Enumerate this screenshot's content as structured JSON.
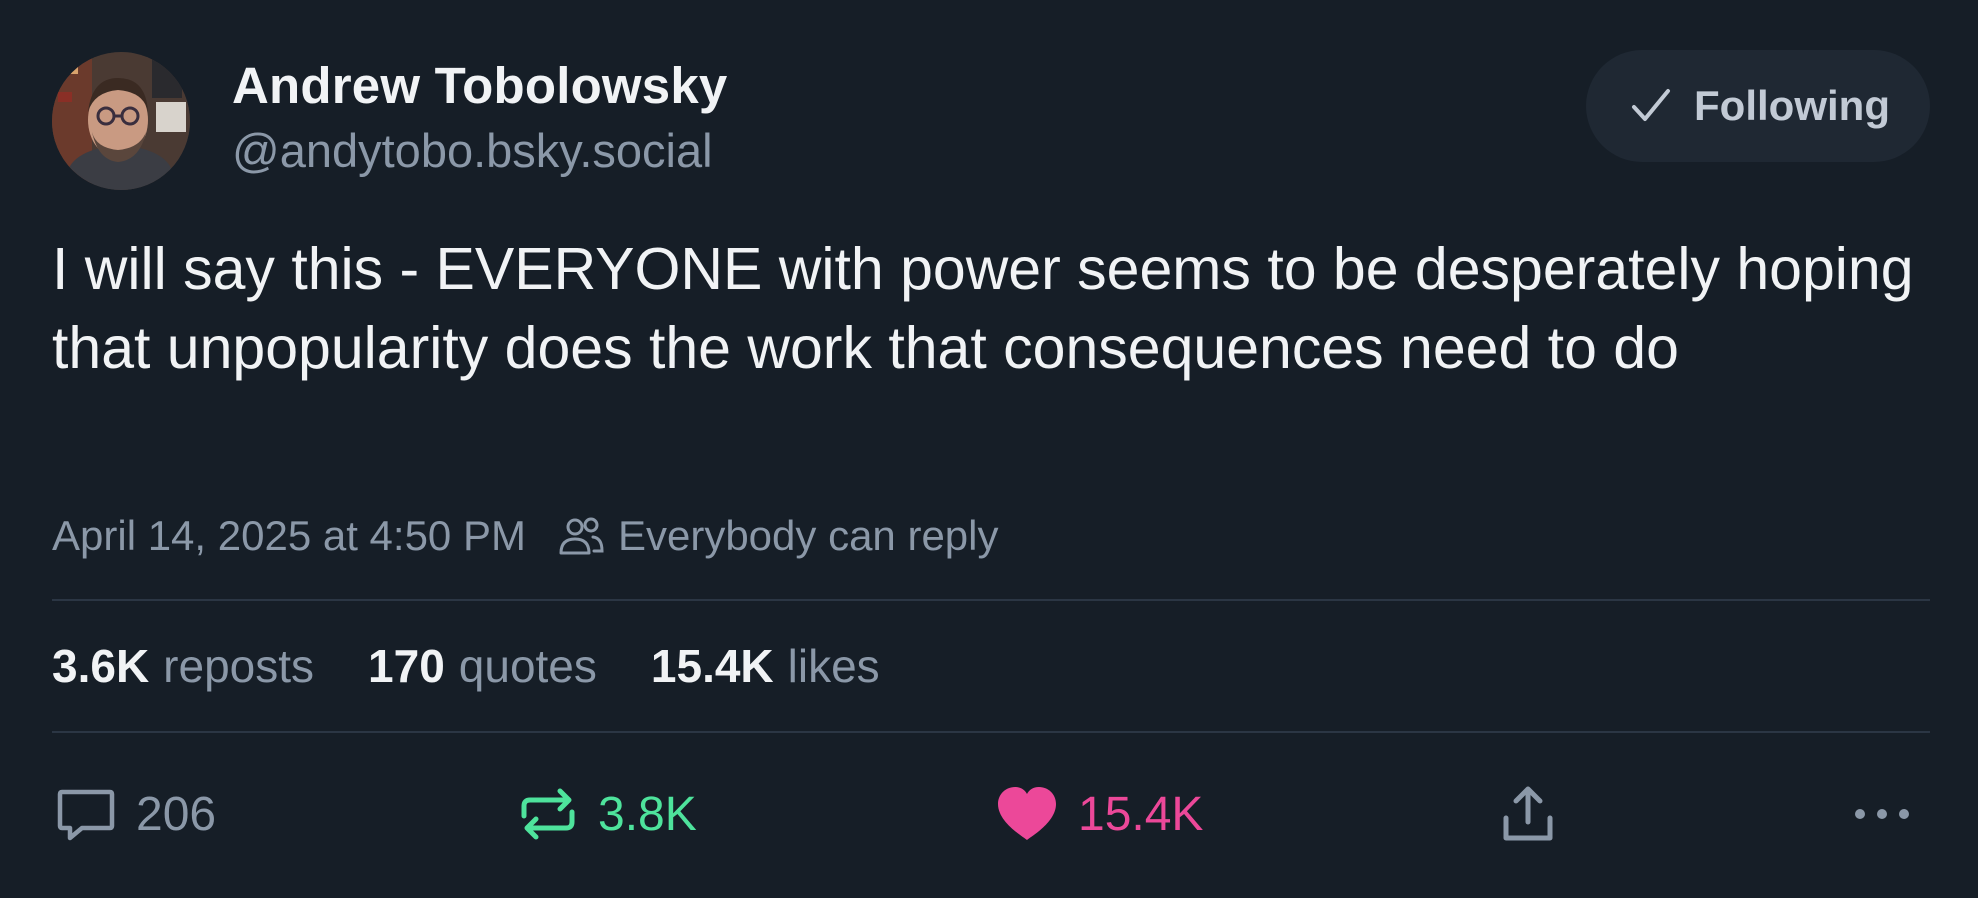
{
  "author": {
    "display_name": "Andrew Tobolowsky",
    "handle": "@andytobo.bsky.social"
  },
  "follow_button": {
    "label": "Following",
    "icon": "check-icon"
  },
  "post": {
    "text": "I will say this - EVERYONE with power seems to be desperately hoping that unpopularity does the work that consequences need to do",
    "timestamp": "April 14, 2025 at 4:50 PM",
    "reply_setting": "Everybody can reply"
  },
  "stats": {
    "reposts": {
      "value": "3.6K",
      "label": "reposts"
    },
    "quotes": {
      "value": "170",
      "label": "quotes"
    },
    "likes": {
      "value": "15.4K",
      "label": "likes"
    }
  },
  "actions": {
    "reply": {
      "count": "206",
      "icon": "reply-bubble-icon",
      "color": "#8b98a8"
    },
    "repost": {
      "count": "3.8K",
      "icon": "repost-icon",
      "color": "#4ee39c"
    },
    "like": {
      "count": "15.4K",
      "icon": "heart-icon",
      "color": "#ec4899"
    },
    "share": {
      "icon": "share-icon"
    },
    "more": {
      "icon": "more-options-icon"
    }
  },
  "colors": {
    "background": "#161e27",
    "text_primary": "#f1f3f5",
    "text_secondary": "#8b98a8",
    "divider": "#2b3644",
    "button_bg": "#1f2833"
  }
}
